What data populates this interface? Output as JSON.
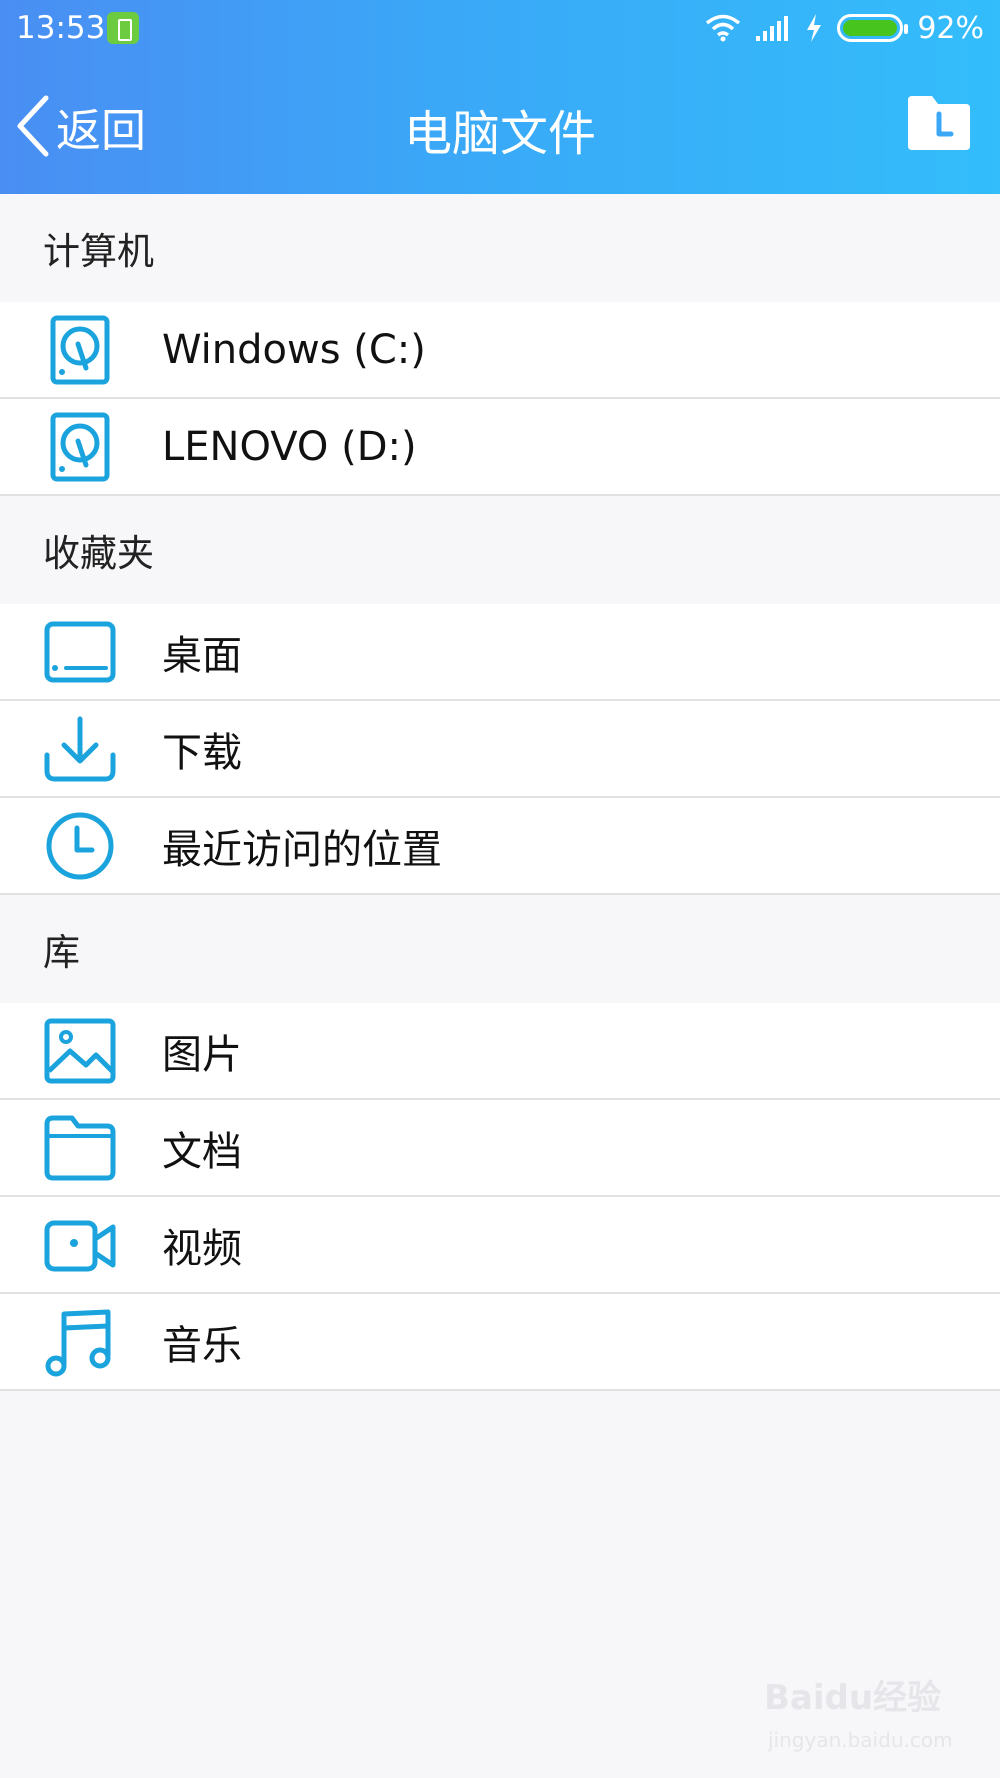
{
  "status_bar": {
    "time": "13:53",
    "battery_percent": "92%",
    "icons": [
      "battery-app-icon",
      "wifi-icon",
      "signal-icon",
      "charging-icon",
      "battery-icon"
    ]
  },
  "header": {
    "back_label": "返回",
    "title": "电脑文件",
    "right_icon": "folder-recent-icon"
  },
  "sections": [
    {
      "title": "计算机",
      "items": [
        {
          "label": "Windows (C:)",
          "icon": "hard-drive-icon"
        },
        {
          "label": "LENOVO (D:)",
          "icon": "hard-drive-icon"
        }
      ]
    },
    {
      "title": "收藏夹",
      "items": [
        {
          "label": "桌面",
          "icon": "desktop-icon"
        },
        {
          "label": "下载",
          "icon": "download-icon"
        },
        {
          "label": "最近访问的位置",
          "icon": "clock-icon"
        }
      ]
    },
    {
      "title": "库",
      "items": [
        {
          "label": "图片",
          "icon": "picture-icon"
        },
        {
          "label": "文档",
          "icon": "folder-icon"
        },
        {
          "label": "视频",
          "icon": "video-icon"
        },
        {
          "label": "音乐",
          "icon": "music-icon"
        }
      ]
    }
  ],
  "colors": {
    "accent": "#1aa3dc",
    "header_gradient_start": "#4a8ef3",
    "header_gradient_end": "#33bdfb",
    "background": "#f7f7f9"
  },
  "watermark": {
    "main": "Baidu经验",
    "sub": "jingyan.baidu.com"
  }
}
